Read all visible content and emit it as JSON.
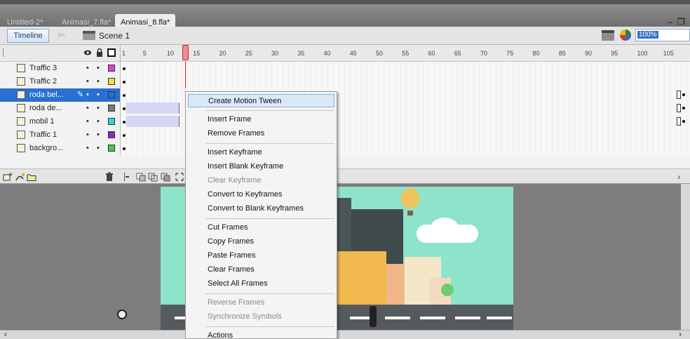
{
  "tabs": [
    {
      "label": "Untitled-2*",
      "active": false
    },
    {
      "label": "Animasi_7.fla*",
      "active": false
    },
    {
      "label": "Animasi_8.fla*",
      "active": true
    }
  ],
  "window_controls": {
    "minimize": "–",
    "restore": "❐"
  },
  "toolbar": {
    "timeline_label": "Timeline",
    "back_icon": "⇦",
    "scene_label": "Scene 1",
    "zoom_value": "100%"
  },
  "ruler": {
    "frames": [
      "1",
      "5",
      "10",
      "15",
      "20",
      "25",
      "30",
      "35",
      "40",
      "45",
      "50",
      "55",
      "60",
      "65",
      "70",
      "75",
      "80",
      "85",
      "90",
      "95",
      "100",
      "105",
      "1"
    ],
    "current_frame": 13
  },
  "layers": [
    {
      "name": "Traffic 3",
      "color": "#e03ce0",
      "selected": false,
      "tween": false,
      "end_keyframe": false
    },
    {
      "name": "Traffic 2",
      "color": "#f0e040",
      "selected": false,
      "tween": false,
      "end_keyframe": false
    },
    {
      "name": "roda bel...",
      "color": "#2a6fd1",
      "selected": true,
      "tween": false,
      "end_keyframe": true
    },
    {
      "name": "roda de...",
      "color": "#7a7a7a",
      "selected": false,
      "tween": true,
      "end_keyframe": true
    },
    {
      "name": "mobil 1",
      "color": "#38d0e0",
      "selected": false,
      "tween": true,
      "end_keyframe": true
    },
    {
      "name": "Traffic 1",
      "color": "#8a28c8",
      "selected": false,
      "tween": false,
      "end_keyframe": false
    },
    {
      "name": "backgro...",
      "color": "#3ad050",
      "selected": false,
      "tween": false,
      "end_keyframe": false
    }
  ],
  "layer_dots": {
    "visible": "•",
    "lock": "•"
  },
  "footer_icons": {
    "new_layer": "⬈",
    "trash": "🗑",
    "scroll_right": "›"
  },
  "stage": {
    "scroll_left": "‹",
    "scroll_right": "›"
  },
  "context_menu": {
    "items": [
      {
        "label": "Create Motion Tween",
        "enabled": true,
        "highlighted": true,
        "group": 0
      },
      {
        "label": "Insert Frame",
        "enabled": true,
        "highlighted": false,
        "group": 1
      },
      {
        "label": "Remove Frames",
        "enabled": true,
        "highlighted": false,
        "group": 1
      },
      {
        "label": "Insert Keyframe",
        "enabled": true,
        "highlighted": false,
        "group": 2
      },
      {
        "label": "Insert Blank Keyframe",
        "enabled": true,
        "highlighted": false,
        "group": 2
      },
      {
        "label": "Clear Keyframe",
        "enabled": false,
        "highlighted": false,
        "group": 2
      },
      {
        "label": "Convert to Keyframes",
        "enabled": true,
        "highlighted": false,
        "group": 2
      },
      {
        "label": "Convert to Blank Keyframes",
        "enabled": true,
        "highlighted": false,
        "group": 2
      },
      {
        "label": "Cut Frames",
        "enabled": true,
        "highlighted": false,
        "group": 3
      },
      {
        "label": "Copy Frames",
        "enabled": true,
        "highlighted": false,
        "group": 3
      },
      {
        "label": "Paste Frames",
        "enabled": true,
        "highlighted": false,
        "group": 3
      },
      {
        "label": "Clear Frames",
        "enabled": true,
        "highlighted": false,
        "group": 3
      },
      {
        "label": "Select All Frames",
        "enabled": true,
        "highlighted": false,
        "group": 3
      },
      {
        "label": "Reverse Frames",
        "enabled": false,
        "highlighted": false,
        "group": 4
      },
      {
        "label": "Synchronize Symbols",
        "enabled": false,
        "highlighted": false,
        "group": 4
      },
      {
        "label": "Actions",
        "enabled": true,
        "highlighted": false,
        "group": 5
      }
    ]
  }
}
